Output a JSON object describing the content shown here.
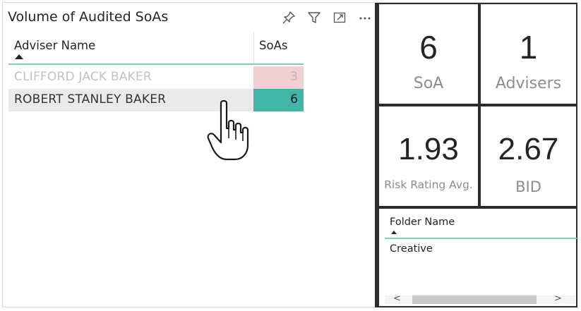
{
  "table_visual": {
    "title": "Volume of Audited SoAs",
    "toolbar": {
      "pin_icon": "pin-icon",
      "filter_icon": "filter-icon",
      "focus_icon": "focus-mode-icon",
      "more_icon": "more-options-icon",
      "more_label": "···"
    },
    "columns": [
      "Adviser Name",
      "SoAs"
    ],
    "rows": [
      {
        "name": "CLIFFORD JACK BAKER",
        "soas": "3"
      },
      {
        "name": "ROBERT STANLEY BAKER",
        "soas": "6"
      }
    ],
    "colors": {
      "accent_line": "#84cdc3",
      "bar_high": "#41b6a6",
      "bar_low": "#f1cfd3"
    }
  },
  "cards": {
    "soa": {
      "value": "6",
      "label": "SoA"
    },
    "advisers": {
      "value": "1",
      "label": "Advisers"
    },
    "risk": {
      "value": "1.93",
      "label": "Risk Rating Avg."
    },
    "bid": {
      "value": "2.67",
      "label": "BID"
    }
  },
  "folder_slicer": {
    "header": "Folder Name",
    "items": [
      "Creative"
    ],
    "scroll_left": "<",
    "scroll_right": ">"
  }
}
